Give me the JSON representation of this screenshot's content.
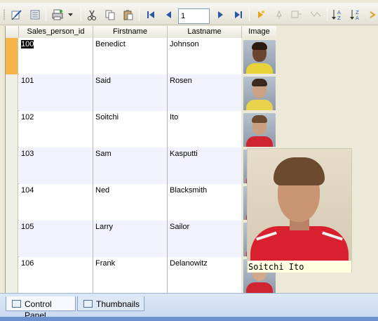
{
  "toolbar": {
    "page_input_value": "1",
    "buttons": [
      "edit-icon",
      "form-view-icon",
      "print-icon",
      "dropdown-arrow-icon",
      "cut-icon",
      "copy-icon",
      "paste-icon",
      "first-record-icon",
      "previous-record-icon",
      "next-record-icon",
      "last-record-icon",
      "new-record-icon",
      "delete-record-icon",
      "filter-icon",
      "refresh-icon",
      "sort-ascending-icon",
      "sort-descending-icon"
    ]
  },
  "grid": {
    "columns": [
      "Sales_person_id",
      "Firstname",
      "Lastname",
      "Image"
    ],
    "rows": [
      {
        "id": "100",
        "first": "Benedict",
        "last": "Johnson",
        "skin": "#6b4530",
        "shirt": "#e7d23a",
        "hair": "#2a1a10"
      },
      {
        "id": "101",
        "first": "Said",
        "last": "Rosen",
        "skin": "#c9a183",
        "shirt": "#e8d34a",
        "hair": "#3b2a1c"
      },
      {
        "id": "102",
        "first": "Soitchi",
        "last": "Ito",
        "skin": "#caa080",
        "shirt": "#cf2431",
        "hair": "#6b4a2f"
      },
      {
        "id": "103",
        "first": "Sam",
        "last": "Kasputti",
        "skin": "#c89a7c",
        "shirt": "#cf2431",
        "hair": "#4a3322"
      },
      {
        "id": "104",
        "first": "Ned",
        "last": "Blacksmith",
        "skin": "#c89a7c",
        "shirt": "#cf2431",
        "hair": "#4a3322"
      },
      {
        "id": "105",
        "first": "Larry",
        "last": "Sailor",
        "skin": "#c89a7c",
        "shirt": "#cf2431",
        "hair": "#4a3322"
      },
      {
        "id": "106",
        "first": "Frank",
        "last": "Delanowitz",
        "skin": "#d3a98c",
        "shirt": "#cf2431",
        "hair": "#5a3f28"
      }
    ]
  },
  "preview": {
    "caption": "Soitchi Ito"
  },
  "tabs": [
    {
      "label": "Control Panel",
      "active": true
    },
    {
      "label": "Thumbnails",
      "active": false
    }
  ],
  "colors": {
    "current_row_indicator": "#f5b54a",
    "alt_row": "#f1f2fb",
    "tab_strip": "#6d90cf"
  }
}
